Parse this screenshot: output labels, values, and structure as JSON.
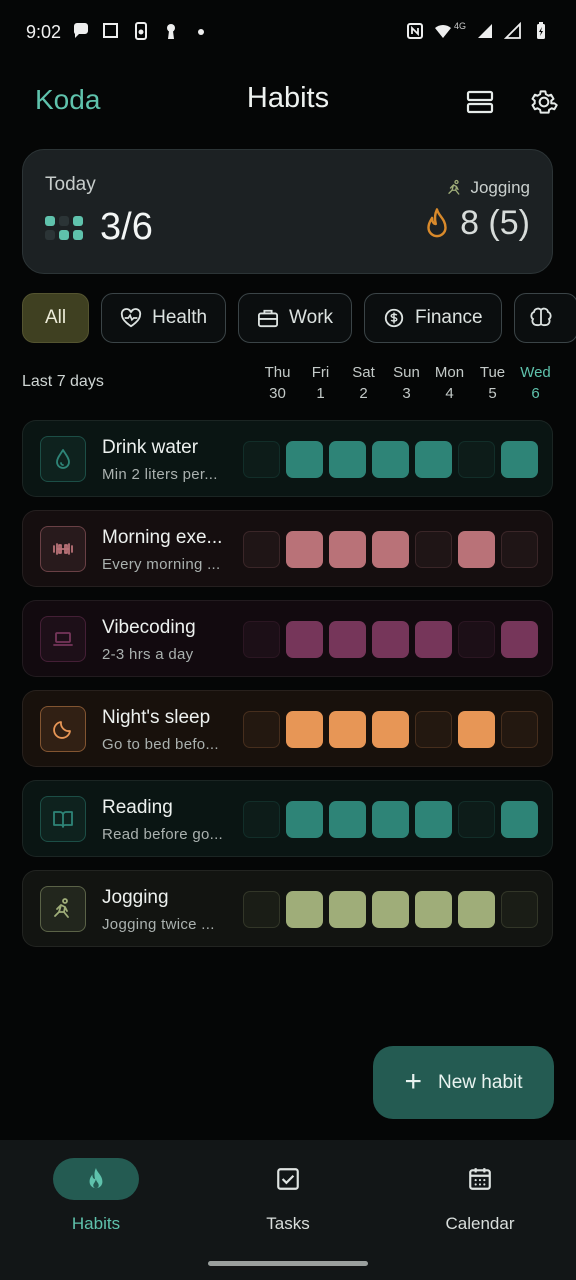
{
  "status_bar": {
    "time": "9:02",
    "network": "4G"
  },
  "app_bar": {
    "brand": "Koda",
    "title": "Habits"
  },
  "summary": {
    "label": "Today",
    "completed": "3/6",
    "streak_habit": "Jogging",
    "streak_text": "8 (5)",
    "progress_dots": [
      1,
      0,
      1,
      0,
      1,
      1
    ]
  },
  "filters": [
    {
      "label": "All",
      "icon": "",
      "active": true
    },
    {
      "label": "Health",
      "icon": "heart-pulse-icon",
      "active": false
    },
    {
      "label": "Work",
      "icon": "briefcase-icon",
      "active": false
    },
    {
      "label": "Finance",
      "icon": "coin-icon",
      "active": false
    },
    {
      "label": "",
      "icon": "brain-icon",
      "active": false
    }
  ],
  "days_header": {
    "label": "Last 7 days",
    "days": [
      {
        "name": "Thu",
        "num": "30"
      },
      {
        "name": "Fri",
        "num": "1"
      },
      {
        "name": "Sat",
        "num": "2"
      },
      {
        "name": "Sun",
        "num": "3"
      },
      {
        "name": "Mon",
        "num": "4"
      },
      {
        "name": "Tue",
        "num": "5"
      },
      {
        "name": "Wed",
        "num": "6",
        "today": true
      }
    ]
  },
  "habits": [
    {
      "name": "Drink water",
      "subtitle": "Min 2 liters per...",
      "icon": "droplet-icon",
      "color": "#2e8477",
      "row_bg": "#0a1513",
      "empty": "#0d1c19",
      "done": [
        0,
        1,
        1,
        1,
        1,
        0,
        1
      ]
    },
    {
      "name": "Morning exe...",
      "subtitle": "Every morning ...",
      "icon": "dumbbell-icon",
      "color": "#b97278",
      "row_bg": "#150e0f",
      "empty": "#1f1516",
      "done": [
        0,
        1,
        1,
        1,
        0,
        1,
        0
      ]
    },
    {
      "name": "Vibecoding",
      "subtitle": "2-3 hrs a day",
      "icon": "laptop-icon",
      "color": "#76365a",
      "row_bg": "#120a0f",
      "empty": "#1c0f17",
      "done": [
        0,
        1,
        1,
        1,
        1,
        0,
        1
      ]
    },
    {
      "name": "Night's sleep",
      "subtitle": "Go to bed befo...",
      "icon": "moon-icon",
      "color": "#e79656",
      "row_bg": "#18110c",
      "empty": "#231810",
      "done": [
        0,
        1,
        1,
        1,
        0,
        1,
        0
      ]
    },
    {
      "name": "Reading",
      "subtitle": "Read before go...",
      "icon": "book-icon",
      "color": "#2e8477",
      "row_bg": "#0a1513",
      "empty": "#0d1c19",
      "done": [
        0,
        1,
        1,
        1,
        1,
        0,
        1
      ]
    },
    {
      "name": "Jogging",
      "subtitle": "Jogging twice ...",
      "icon": "running-icon",
      "color": "#9fad79",
      "row_bg": "#121411",
      "empty": "#1a1d16",
      "done": [
        0,
        1,
        1,
        1,
        1,
        1,
        0
      ]
    }
  ],
  "fab": {
    "label": "New habit"
  },
  "bottom_nav": [
    {
      "label": "Habits",
      "icon": "flame-icon",
      "active": true
    },
    {
      "label": "Tasks",
      "icon": "checkbox-icon",
      "active": false
    },
    {
      "label": "Calendar",
      "icon": "calendar-icon",
      "active": false
    }
  ],
  "colors": {
    "accent": "#5fc2ac",
    "fab": "#245b52",
    "streak": "#d98a2b"
  }
}
